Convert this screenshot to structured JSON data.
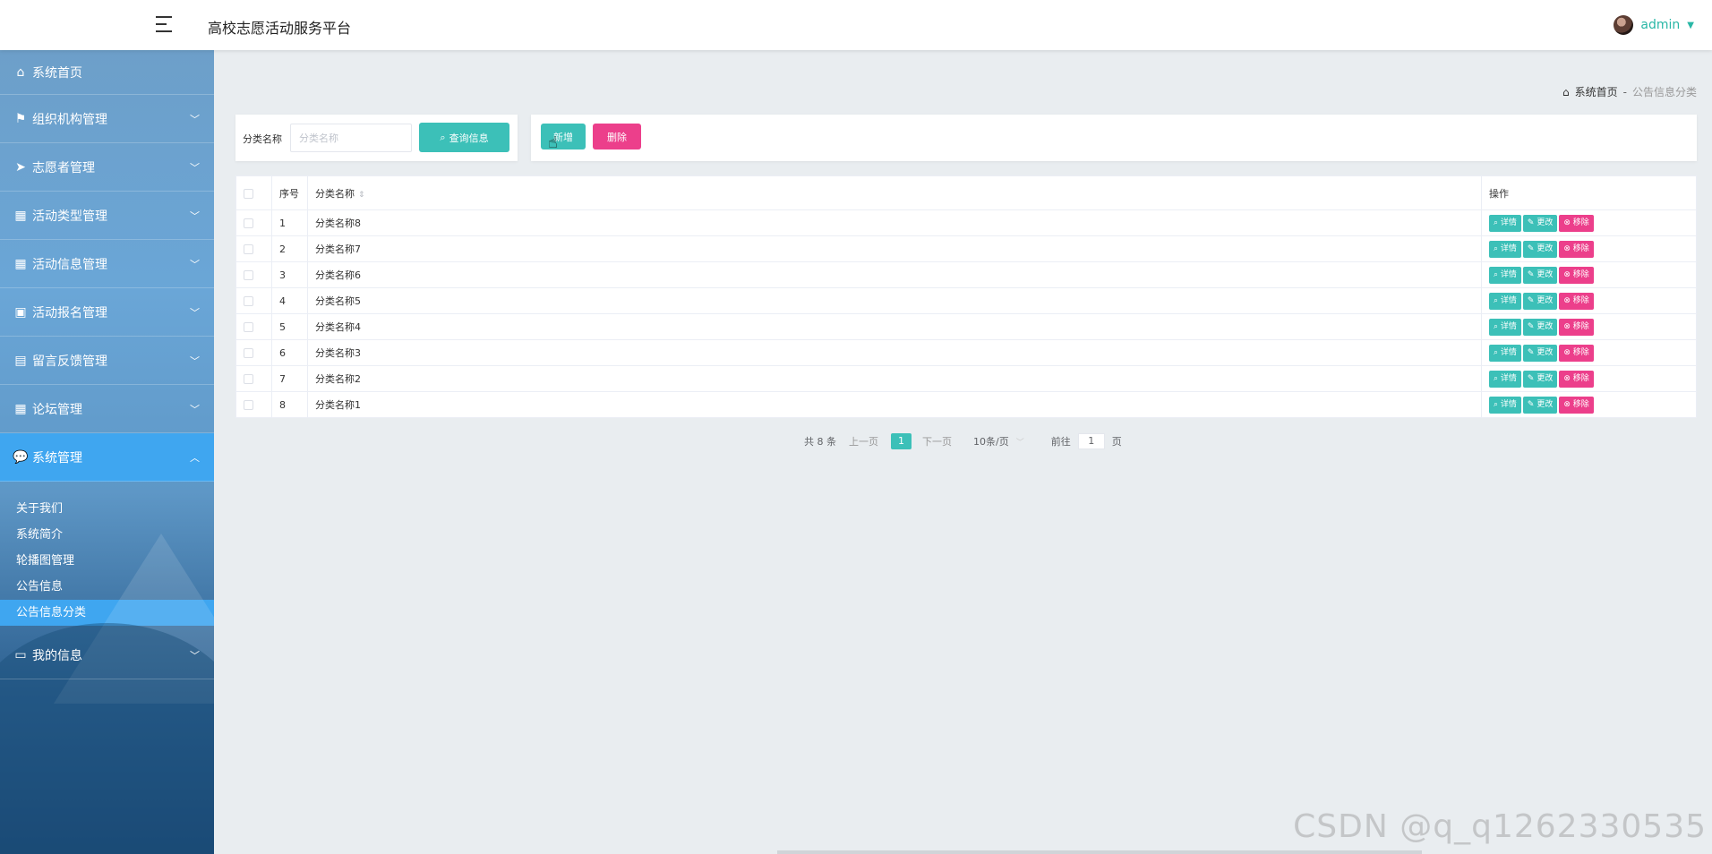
{
  "header": {
    "title": "高校志愿活动服务平台",
    "user_name": "admin"
  },
  "sidebar": {
    "items": [
      {
        "label": "系统首页",
        "icon": "home-icon"
      },
      {
        "label": "组织机构管理",
        "icon": "flag-icon"
      },
      {
        "label": "志愿者管理",
        "icon": "paper-plane-icon"
      },
      {
        "label": "活动类型管理",
        "icon": "grid-icon"
      },
      {
        "label": "活动信息管理",
        "icon": "grid-icon"
      },
      {
        "label": "活动报名管理",
        "icon": "briefcase-icon"
      },
      {
        "label": "留言反馈管理",
        "icon": "clipboard-icon"
      },
      {
        "label": "论坛管理",
        "icon": "grid-icon"
      },
      {
        "label": "系统管理",
        "icon": "chat-icon"
      },
      {
        "label": "我的信息",
        "icon": "wallet-icon"
      }
    ],
    "submenu": [
      {
        "label": "关于我们"
      },
      {
        "label": "系统简介"
      },
      {
        "label": "轮播图管理"
      },
      {
        "label": "公告信息"
      },
      {
        "label": "公告信息分类"
      }
    ]
  },
  "breadcrumb": {
    "home": "系统首页",
    "separator": "-",
    "current": "公告信息分类"
  },
  "search": {
    "label": "分类名称",
    "placeholder": "分类名称",
    "query_button": "查询信息"
  },
  "actions": {
    "add": "新增",
    "delete": "删除"
  },
  "table": {
    "headers": {
      "index": "序号",
      "name": "分类名称",
      "ops": "操作"
    },
    "ops": {
      "detail": "详情",
      "edit": "更改",
      "remove": "移除"
    },
    "rows": [
      {
        "index": "1",
        "name": "分类名称8"
      },
      {
        "index": "2",
        "name": "分类名称7"
      },
      {
        "index": "3",
        "name": "分类名称6"
      },
      {
        "index": "4",
        "name": "分类名称5"
      },
      {
        "index": "5",
        "name": "分类名称4"
      },
      {
        "index": "6",
        "name": "分类名称3"
      },
      {
        "index": "7",
        "name": "分类名称2"
      },
      {
        "index": "8",
        "name": "分类名称1"
      }
    ]
  },
  "pagination": {
    "total": "共 8 条",
    "prev": "上一页",
    "page": "1",
    "next": "下一页",
    "page_size": "10条/页",
    "goto_label": "前往",
    "goto_value": "1",
    "goto_unit": "页"
  },
  "watermark": "CSDN @q_q1262330535",
  "colors": {
    "accent": "#3cc0b8",
    "danger": "#ec3f8b",
    "active_menu": "#3fa6f0"
  }
}
